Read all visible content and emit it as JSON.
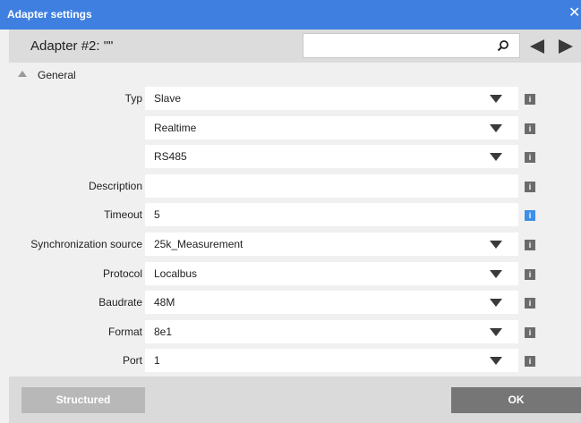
{
  "window": {
    "title": "Adapter settings",
    "close_label": "✕"
  },
  "header": {
    "adapter_name": "Adapter #2: \"\"",
    "search": {
      "value": "",
      "placeholder": ""
    }
  },
  "section": {
    "label": "General",
    "expanded": true
  },
  "rows": [
    {
      "label": "Typ",
      "value": "Slave",
      "kind": "dropdown",
      "info_active": false
    },
    {
      "label": "",
      "value": "Realtime",
      "kind": "dropdown",
      "info_active": false
    },
    {
      "label": "",
      "value": "RS485",
      "kind": "dropdown",
      "info_active": false
    },
    {
      "label": "Description",
      "value": "",
      "kind": "text",
      "info_active": false
    },
    {
      "label": "Timeout",
      "value": "5",
      "kind": "text",
      "info_active": true
    },
    {
      "label": "Synchronization source",
      "value": "25k_Measurement",
      "kind": "dropdown",
      "info_active": false
    },
    {
      "label": "Protocol",
      "value": "Localbus",
      "kind": "dropdown",
      "info_active": false
    },
    {
      "label": "Baudrate",
      "value": "48M",
      "kind": "dropdown",
      "info_active": false
    },
    {
      "label": "Format",
      "value": "8e1",
      "kind": "dropdown",
      "info_active": false
    },
    {
      "label": "Port",
      "value": "1",
      "kind": "dropdown",
      "info_active": false
    }
  ],
  "info_icon_glyph": "i",
  "footer": {
    "structured_label": "Structured",
    "ok_label": "OK"
  },
  "colors": {
    "titlebar": "#3f7fe0",
    "info_active": "#3f8ee8",
    "info_inactive": "#6b6b6b",
    "ok_button": "#767676",
    "structured_button": "#b8b8b8"
  }
}
